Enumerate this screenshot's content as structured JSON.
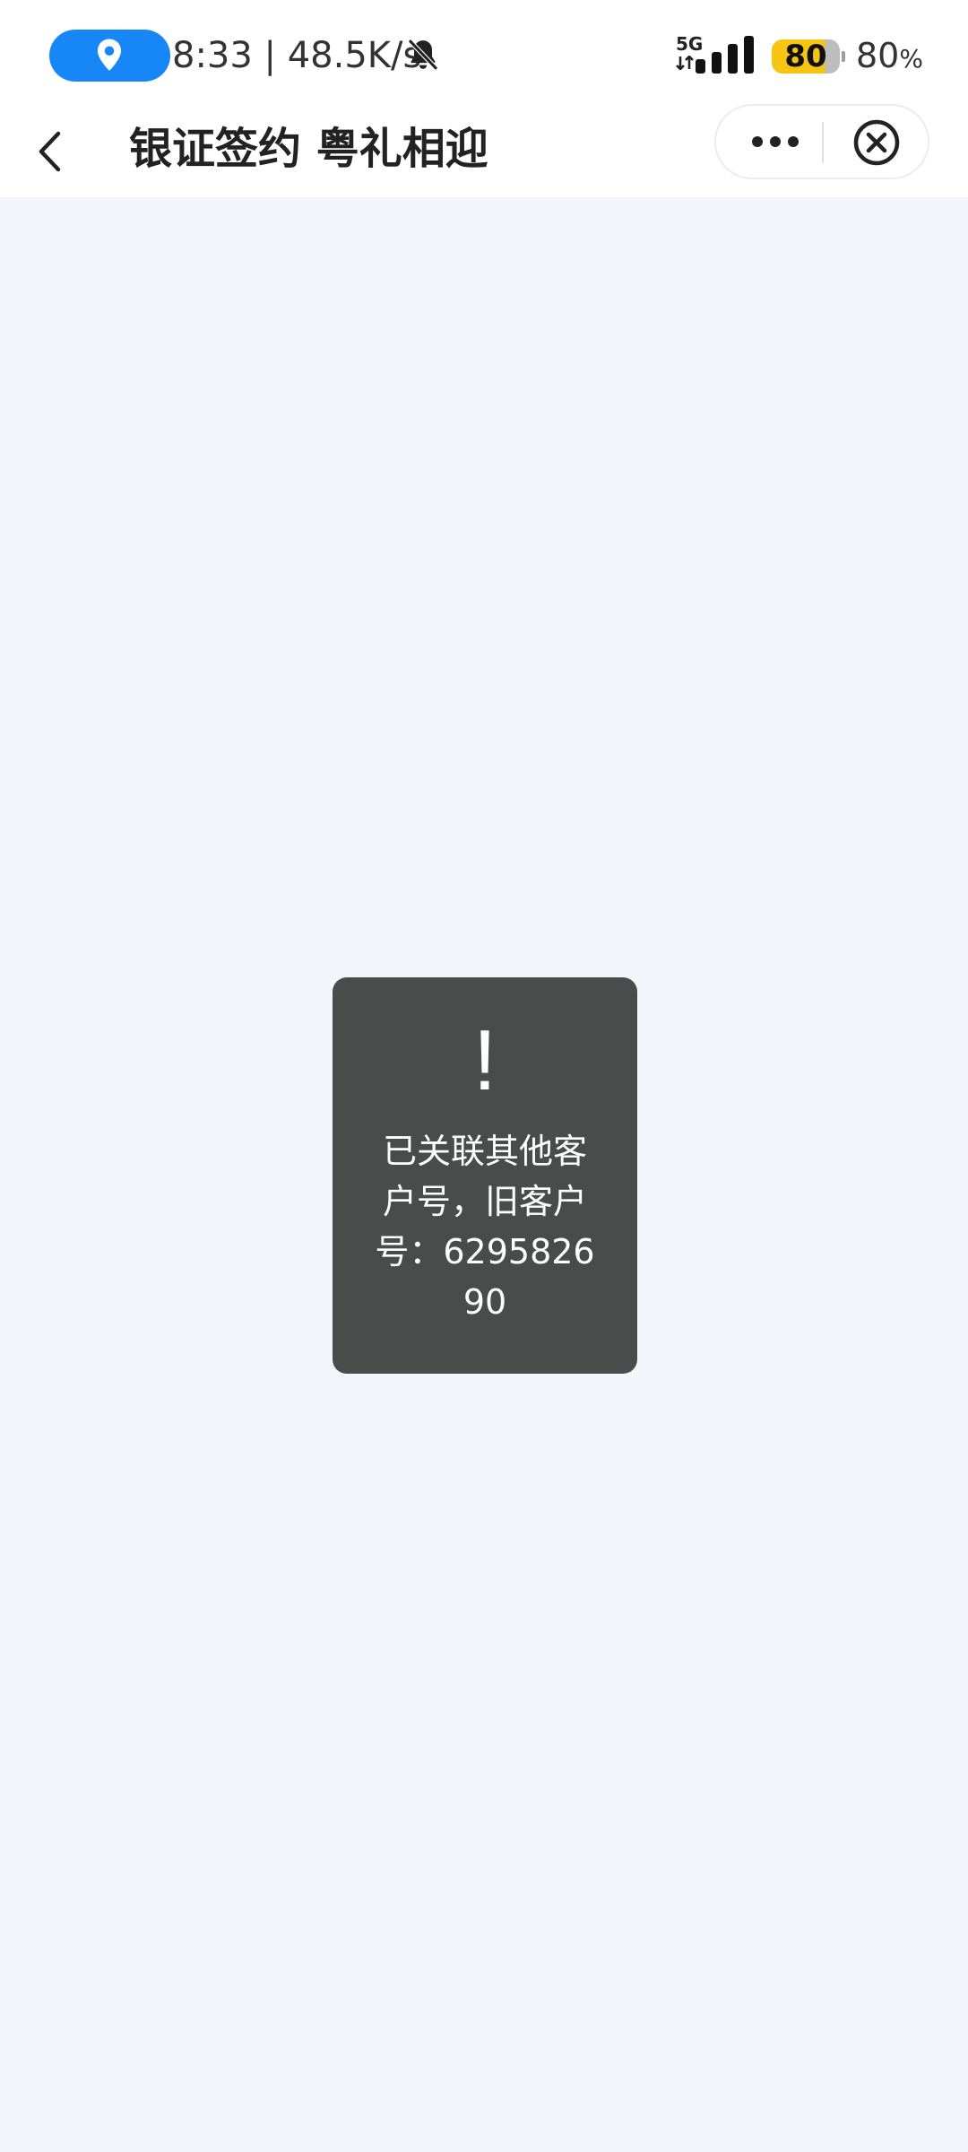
{
  "status_bar": {
    "time_speed": "8:33 | 48.5K/s",
    "network_type": "5G",
    "battery_level": "80",
    "battery_percent_value": "80",
    "battery_percent_sign": "%",
    "icons": [
      "location-icon",
      "bell-off-icon",
      "signal-icon",
      "battery-icon"
    ],
    "location_pill_color": "#1787f7",
    "battery_color": "#f6c512"
  },
  "nav": {
    "title": "银证签约 粤礼相迎",
    "icons": [
      "back-arrow-icon",
      "more-icon",
      "close-circle-icon"
    ]
  },
  "toast": {
    "icon": "!",
    "message": "已关联其他客户号，旧客户号：629582690"
  }
}
